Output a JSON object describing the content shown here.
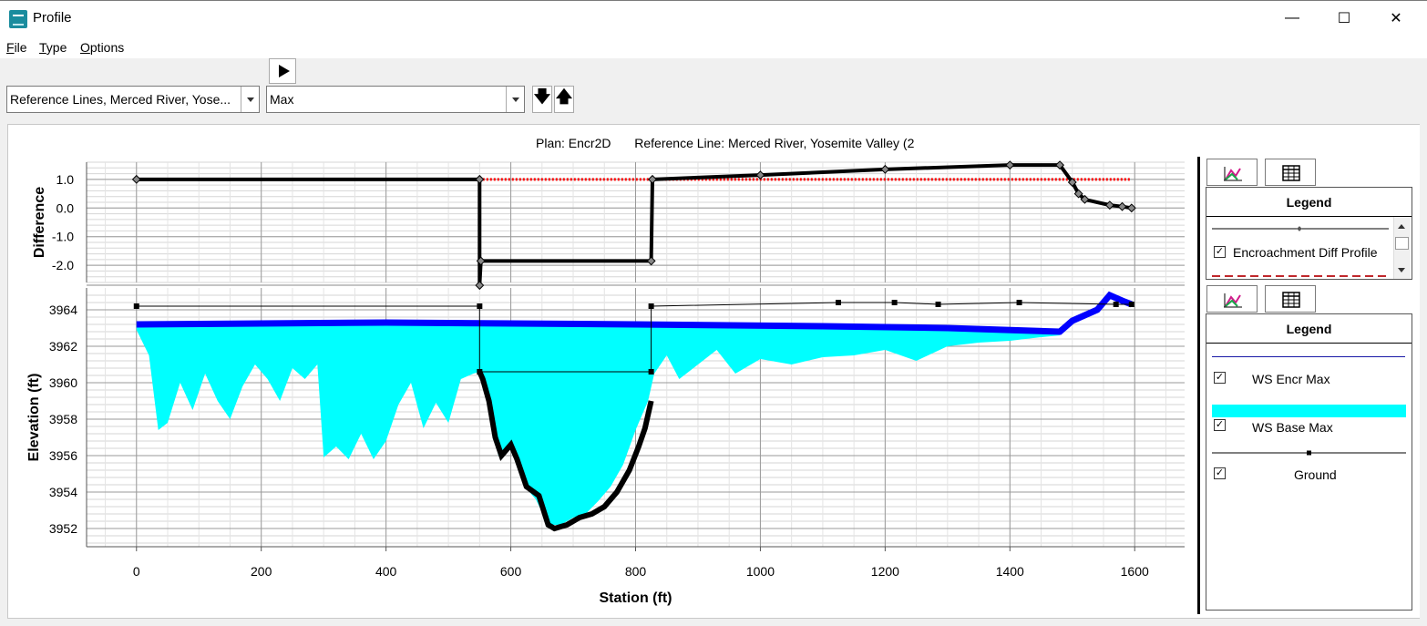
{
  "window": {
    "title": "Profile",
    "minimize": "—",
    "maximize": "☐",
    "close": "✕"
  },
  "menu": [
    {
      "label": "File",
      "u": "F",
      "rest": "ile"
    },
    {
      "label": "Type",
      "u": "T",
      "rest": "ype"
    },
    {
      "label": "Options",
      "u": "O",
      "rest": "ptions"
    }
  ],
  "toolbar": {
    "reference_select": "Reference Lines, Merced River, Yose...",
    "profile_select": "Max",
    "down_label": "🡇",
    "up_label": "🡅"
  },
  "plot_header": {
    "plan": "Plan: Encr2D",
    "reference_line": "Reference Line: Merced River, Yosemite Valley (2"
  },
  "top_legend": {
    "title": "Legend",
    "items": [
      {
        "label": "Encroachment Diff Profile",
        "checked": true
      }
    ]
  },
  "bottom_legend": {
    "title": "Legend",
    "items": [
      {
        "label": "WS Encr Max",
        "checked": true,
        "color": "#1a1aa6"
      },
      {
        "label": "WS Base Max",
        "checked": true,
        "color": "#00ffff"
      },
      {
        "label": "Ground",
        "checked": true,
        "color": "#000000"
      }
    ]
  },
  "chart_data": [
    {
      "type": "line",
      "ylabel": "Difference",
      "ylim": [
        -2.6,
        1.6
      ],
      "yticks": [
        "1.0",
        "0.0",
        "-1.0",
        "-2.0"
      ],
      "ytick_values": [
        1.0,
        0.0,
        -1.0,
        -2.0
      ],
      "series": [
        {
          "name": "Encroachment Diff Profile",
          "color": "#000000",
          "x": [
            0,
            550,
            550,
            552,
            825,
            827,
            1000,
            1200,
            1400,
            1480,
            1500,
            1510,
            1520,
            1560,
            1580,
            1595
          ],
          "y": [
            1.0,
            1.0,
            -2.7,
            -1.85,
            -1.85,
            1.0,
            1.15,
            1.35,
            1.5,
            1.5,
            0.9,
            0.5,
            0.3,
            0.1,
            0.05,
            0.0
          ]
        },
        {
          "color": "#ff0000",
          "x": [
            0,
            1595
          ],
          "y": [
            1.0,
            1.0
          ]
        }
      ]
    },
    {
      "type": "area",
      "ylabel": "Elevation (ft)",
      "xlabel": "Station (ft)",
      "xlim": [
        -80,
        1680
      ],
      "ylim": [
        3951,
        3965.2
      ],
      "xticks": [
        "0",
        "200",
        "400",
        "600",
        "800",
        "1000",
        "1200",
        "1400",
        "1600"
      ],
      "xtick_values": [
        0,
        200,
        400,
        600,
        800,
        1000,
        1200,
        1400,
        1600
      ],
      "yticks": [
        "3964",
        "3962",
        "3960",
        "3958",
        "3956",
        "3954",
        "3952"
      ],
      "ytick_values": [
        3964,
        3962,
        3960,
        3958,
        3956,
        3954,
        3952
      ],
      "series": [
        {
          "name": "WS Encr Max",
          "color": "#1a1aa6",
          "x": [
            0,
            550,
            550,
            825,
            825,
            1125,
            1215,
            1285,
            1415,
            1570,
            1595
          ],
          "y": [
            3964.2,
            3964.2,
            3960.6,
            3960.6,
            3964.2,
            3964.4,
            3964.4,
            3964.3,
            3964.4,
            3964.3,
            3964.3
          ]
        },
        {
          "name": "WS Base Max",
          "color": "#0000ff",
          "x": [
            0,
            400,
            800,
            1100,
            1300,
            1480,
            1500,
            1540,
            1560,
            1580,
            1595
          ],
          "y": [
            3963.2,
            3963.3,
            3963.2,
            3963.1,
            3963.0,
            3962.8,
            3963.4,
            3964.0,
            3964.8,
            3964.5,
            3964.3
          ]
        },
        {
          "name": "Ground",
          "color": "#000000",
          "x": [
            550,
            555,
            565,
            575,
            585,
            600,
            610,
            625,
            645,
            660,
            670,
            690,
            710,
            730,
            750,
            770,
            790,
            805,
            815,
            825
          ],
          "y": [
            3960.6,
            3960.2,
            3959.0,
            3957.0,
            3956.0,
            3956.6,
            3955.8,
            3954.3,
            3953.8,
            3952.2,
            3952.0,
            3952.2,
            3952.6,
            3952.8,
            3953.2,
            3954.0,
            3955.2,
            3956.5,
            3957.5,
            3959.0
          ]
        },
        {
          "name": "Base water area",
          "color": "#00ffff",
          "x": [
            0,
            20,
            35,
            50,
            70,
            90,
            110,
            130,
            150,
            170,
            190,
            210,
            230,
            250,
            270,
            290,
            300,
            320,
            340,
            360,
            380,
            400,
            420,
            440,
            460,
            480,
            500,
            520,
            540,
            550,
            560,
            580,
            600,
            620,
            640,
            660,
            680,
            700,
            720,
            740,
            760,
            780,
            800,
            820,
            830,
            850,
            870,
            900,
            930,
            960,
            1000,
            1050,
            1100,
            1150,
            1200,
            1250,
            1300,
            1350,
            1400,
            1450,
            1480
          ],
          "y": [
            3962.9,
            3961.5,
            3957.4,
            3957.8,
            3960.0,
            3958.5,
            3960.5,
            3959.0,
            3958.0,
            3959.8,
            3961.0,
            3960.2,
            3959.0,
            3960.8,
            3960.2,
            3961.0,
            3955.9,
            3956.5,
            3955.8,
            3957.2,
            3955.8,
            3956.8,
            3958.8,
            3960.0,
            3957.5,
            3958.9,
            3957.8,
            3960.2,
            3960.5,
            3960.6,
            3959.8,
            3956.0,
            3956.6,
            3954.4,
            3953.6,
            3952.2,
            3952.2,
            3952.6,
            3952.8,
            3953.5,
            3954.3,
            3955.5,
            3957.4,
            3959.0,
            3960.5,
            3961.5,
            3960.2,
            3961.0,
            3961.8,
            3960.5,
            3961.3,
            3961.0,
            3961.4,
            3961.5,
            3961.8,
            3961.2,
            3962.0,
            3962.2,
            3962.3,
            3962.5,
            3962.6
          ]
        }
      ]
    }
  ]
}
